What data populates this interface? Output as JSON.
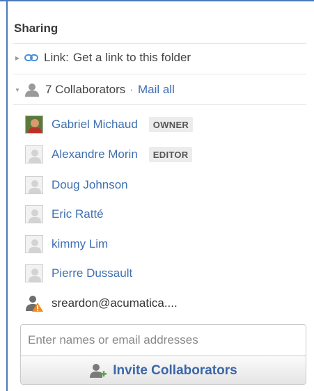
{
  "sharing": {
    "title": "Sharing",
    "link_row": {
      "label": "Link:",
      "text": "Get a link to this folder",
      "icon": "chain-link-icon"
    },
    "collaborators_row": {
      "count_text": "7 Collaborators",
      "separator": "·",
      "mail_all": "Mail all",
      "icon": "people-icon"
    },
    "members": [
      {
        "name": "Gabriel Michaud",
        "role": "OWNER",
        "avatar": "photo"
      },
      {
        "name": "Alexandre Morin",
        "role": "EDITOR",
        "avatar": "placeholder"
      },
      {
        "name": "Doug Johnson",
        "role": "",
        "avatar": "placeholder"
      },
      {
        "name": "Eric Ratté",
        "role": "",
        "avatar": "placeholder"
      },
      {
        "name": "kimmy Lim",
        "role": "",
        "avatar": "placeholder"
      },
      {
        "name": "Pierre Dussault",
        "role": "",
        "avatar": "placeholder"
      }
    ],
    "pending": {
      "email": "sreardon@acumatica....",
      "icon": "user-warning-icon"
    },
    "invite": {
      "placeholder": "Enter names or email addresses",
      "value": "",
      "button_label": "Invite Collaborators",
      "button_icon": "add-user-icon"
    }
  },
  "colors": {
    "frame": "#4a79b8",
    "link": "#3e6fb1",
    "warning": "#f08a1c"
  }
}
